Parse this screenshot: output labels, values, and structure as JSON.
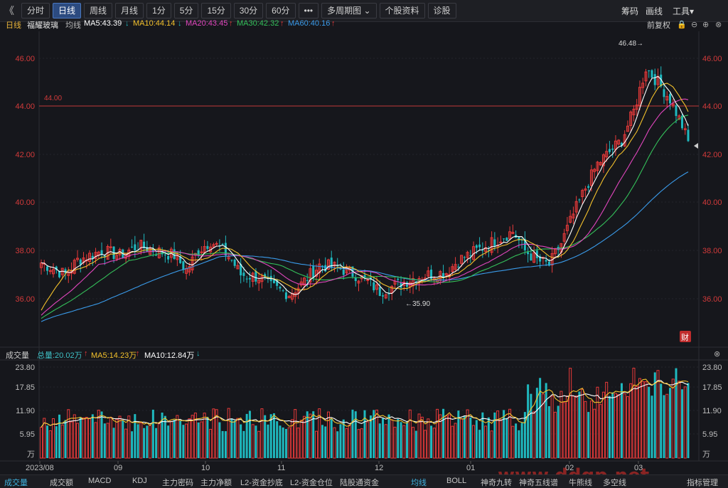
{
  "toolbar": {
    "back": "《",
    "items": [
      "分时",
      "日线",
      "周线",
      "月线",
      "1分",
      "5分",
      "15分",
      "30分",
      "60分",
      "•••",
      "多周期图 ⌄",
      "个股资料",
      "诊股"
    ],
    "active_index": 1,
    "right": [
      "筹码",
      "画线",
      "工具▾"
    ]
  },
  "header": {
    "period_label": "日线",
    "stock_name": "福耀玻璃",
    "ma_title": "均线",
    "ma5": "MA5:43.39",
    "ma10": "MA10:44.14",
    "ma20": "MA20:43.45",
    "ma30": "MA30:42.32",
    "ma60": "MA60:40.16",
    "arrow_down": "↓",
    "arrow_up": "↑",
    "adjust": "前复权"
  },
  "price_axis": {
    "ticks": [
      "46.00",
      "44.00",
      "42.00",
      "40.00",
      "38.00",
      "36.00"
    ],
    "ref_line_label": "44.00",
    "high_label": "46.48",
    "low_label": "35.90",
    "high_arrow": "→",
    "low_arrow": "←",
    "badge": "财"
  },
  "volume": {
    "title": "成交量",
    "total": "总量:20.02万",
    "ma5": "MA5:14.23万",
    "ma10": "MA10:12.84万",
    "arrow_up": "↑",
    "arrow_down": "↓",
    "ticks": [
      "23.80",
      "17.85",
      "11.90",
      "5.95",
      "万"
    ]
  },
  "x_axis": {
    "labels": [
      "2023/08",
      "09",
      "10",
      "11",
      "12",
      "01",
      "02",
      "03"
    ]
  },
  "bottom_tabs": [
    "成交量",
    "成交额",
    "MACD",
    "KDJ",
    "主力密码",
    "主力净额",
    "L2-资金抄底",
    "L2-资金仓位",
    "陆股通资金",
    "均线",
    "BOLL",
    "神奇九转",
    "神奇五线谱",
    "牛熊线",
    "多空线",
    "指标管理"
  ],
  "colors": {
    "up": "#e83a3a",
    "down": "#1fb9bf",
    "ma5": "#ffffff",
    "ma10": "#f3c12c",
    "ma20": "#e046bd",
    "ma30": "#34c05a",
    "ma60": "#3a9bea",
    "ref": "#c33a3a"
  },
  "watermark": "www.ddgp.net"
}
